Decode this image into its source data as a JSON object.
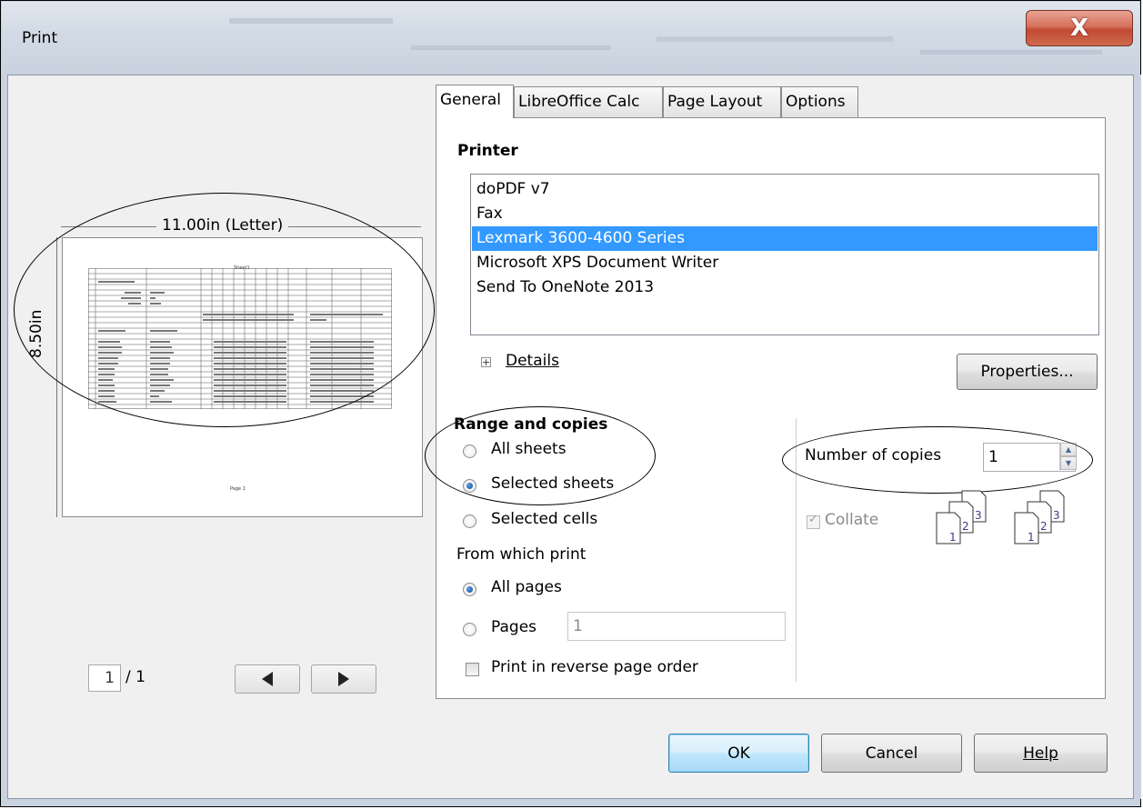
{
  "window": {
    "title": "Print",
    "close_glyph": "X"
  },
  "preview": {
    "paper_width_label": "11.00in (Letter)",
    "paper_height_label": "8.50in",
    "sheet_title": "Sheet1",
    "page_footer": "Page 1",
    "current_page": "1",
    "page_count": "/ 1",
    "prev_icon": "triangle-left-icon",
    "next_icon": "triangle-right-icon"
  },
  "tabs": [
    {
      "label": "General",
      "active": true
    },
    {
      "label": "LibreOffice Calc",
      "active": false
    },
    {
      "label": "Page Layout",
      "active": false
    },
    {
      "label": "Options",
      "active": false
    }
  ],
  "printer": {
    "section_title": "Printer",
    "items": [
      "doPDF v7",
      "Fax",
      "Lexmark 3600-4600 Series",
      "Microsoft XPS Document Writer",
      "Send To OneNote 2013"
    ],
    "selected_index": 2,
    "details_label": "Details",
    "properties_label": "Properties..."
  },
  "range": {
    "section_title": "Range and copies",
    "all_sheets": "All sheets",
    "selected_sheets": "Selected sheets",
    "selected_cells": "Selected cells",
    "selected_option": "Selected sheets",
    "from_which_print": "From which print",
    "all_pages": "All pages",
    "pages": "Pages",
    "pages_value": "1",
    "pages_selected_option": "All pages",
    "reverse_order": "Print in reverse page order",
    "reverse_checked": false
  },
  "copies": {
    "label": "Number of copies",
    "value": "1",
    "collate_label": "Collate",
    "collate_checked": true,
    "collate_enabled": false,
    "collate_icons": [
      "1",
      "2",
      "3"
    ]
  },
  "buttons": {
    "ok": "OK",
    "cancel": "Cancel",
    "help": "Help"
  },
  "colors": {
    "selection": "#3399ff",
    "dialog_bg": "#f0f0f0",
    "close_button": "#c24a33"
  }
}
